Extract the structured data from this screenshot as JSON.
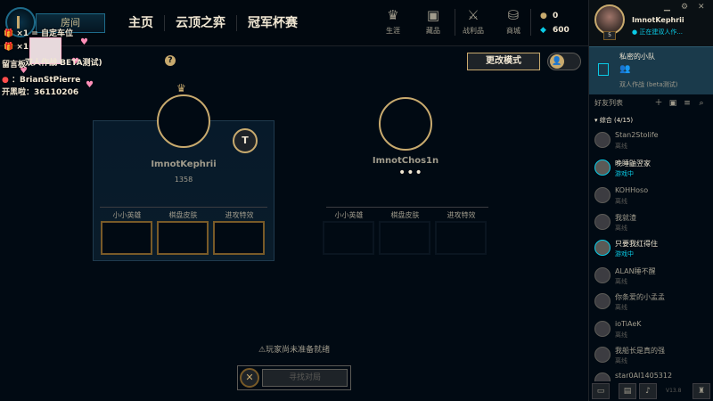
{
  "topbar": {
    "room_label": "房间",
    "nav": [
      "主页",
      "云顶之弈",
      "冠军杯赛"
    ],
    "icons": [
      {
        "icon": "profile-icon",
        "label": "生涯"
      },
      {
        "icon": "collection-icon",
        "label": "藏品"
      },
      {
        "icon": "loot-icon",
        "label": "战利品"
      },
      {
        "icon": "store-icon",
        "label": "商城"
      }
    ],
    "rp": "0",
    "be": "600"
  },
  "overlay": {
    "line1": "×1 = 自定车位",
    "line2": "×1",
    "line3": "留言板",
    "line4": "：BrianStPierre",
    "line5": "开黑啦：36110206"
  },
  "lobby": {
    "mode_title": "双人作战 BETA测试)",
    "change_mode": "更改模式",
    "players": [
      {
        "name": "ImnotKephrii",
        "score": "1358",
        "slot_labels": [
          "小小英雄",
          "棋盘皮肤",
          "进攻特效"
        ]
      },
      {
        "name": "ImnotChos1n",
        "status": "•••",
        "slot_labels": [
          "小小英雄",
          "棋盘皮肤",
          "进攻特效"
        ]
      }
    ],
    "tft_badge": "T",
    "ready_text": "⚠玩家尚未准备就绪",
    "cancel": "✕",
    "find_match": "寻找对局"
  },
  "rpanel": {
    "me_name": "ImnotKephrii",
    "me_status": "正在建双人作...",
    "me_level": "5",
    "party_title": "私密的小队",
    "party_mode": "双人作战 (beta测试)",
    "friends_title": "好友列表",
    "group": "综合 (4/15)",
    "friends": [
      {
        "name": "Stan2Stolife",
        "status": "离线",
        "online": false
      },
      {
        "name": "晚睡鼬翌家",
        "status": "游戏中",
        "online": true
      },
      {
        "name": "KOHHoso",
        "status": "离线",
        "online": false
      },
      {
        "name": "我就渣",
        "status": "离线",
        "online": false
      },
      {
        "name": "只要我红得住",
        "status": "游戏中",
        "online": true
      },
      {
        "name": "ALAN睡不醒",
        "status": "离线",
        "online": false
      },
      {
        "name": "你条爱的小孟孟",
        "status": "离线",
        "online": false
      },
      {
        "name": "ioTiAeK",
        "status": "离线",
        "online": false
      },
      {
        "name": "我船长是真的强",
        "status": "离线",
        "online": false
      },
      {
        "name": "star0AI1405312",
        "status": "",
        "online": false
      }
    ],
    "version": "V13.8"
  }
}
